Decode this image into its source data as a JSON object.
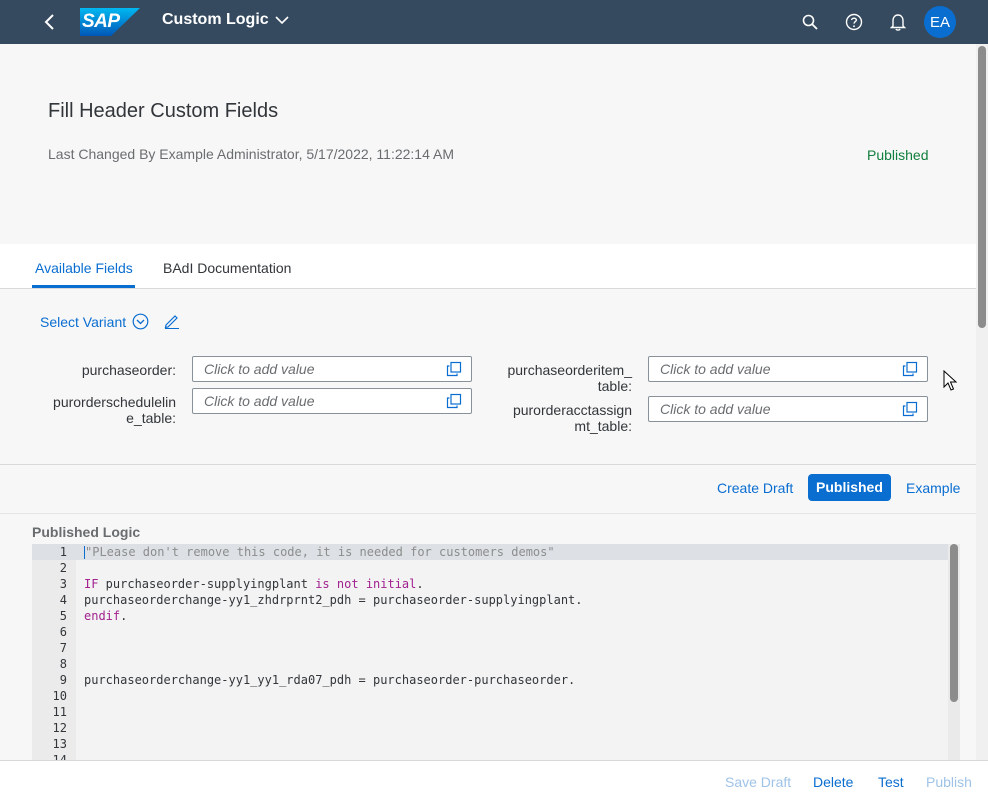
{
  "shell": {
    "logo_text": "SAP",
    "app_title": "Custom Logic",
    "user_initials": "EA"
  },
  "header": {
    "title": "Fill Header Custom Fields",
    "last_changed": "Last Changed By Example Administrator, 5/17/2022, 11:22:14 AM",
    "status": "Published"
  },
  "tabs": [
    {
      "label": "Available Fields"
    },
    {
      "label": "BAdI Documentation"
    }
  ],
  "filter": {
    "variant_label": "Select Variant",
    "fields": [
      {
        "label_line1": "purchaseorder:",
        "label_line2": "",
        "placeholder": "Click to add value"
      },
      {
        "label_line1": "purorderschedulelin",
        "label_line2": "e_table:",
        "placeholder": "Click to add value"
      },
      {
        "label_line1": "purchaseorderitem_",
        "label_line2": "table:",
        "placeholder": "Click to add value"
      },
      {
        "label_line1": "purorderacctassign",
        "label_line2": "mt_table:",
        "placeholder": "Click to add value"
      }
    ]
  },
  "toolbar": {
    "create_draft": "Create Draft",
    "published": "Published",
    "example": "Example"
  },
  "code": {
    "title": "Published Logic",
    "lines": [
      {
        "num": "1",
        "text": "\"PLease don't remove this code, it is needed for customers demos\""
      },
      {
        "num": "2",
        "text": ""
      },
      {
        "num": "3",
        "text": "IF purchaseorder-supplyingplant is not initial."
      },
      {
        "num": "4",
        "text": "purchaseorderchange-yy1_zhdrprnt2_pdh = purchaseorder-supplyingplant."
      },
      {
        "num": "5",
        "text": "endif."
      },
      {
        "num": "6",
        "text": ""
      },
      {
        "num": "7",
        "text": ""
      },
      {
        "num": "8",
        "text": ""
      },
      {
        "num": "9",
        "text": "purchaseorderchange-yy1_yy1_rda07_pdh = purchaseorder-purchaseorder."
      },
      {
        "num": "10",
        "text": ""
      },
      {
        "num": "11",
        "text": ""
      },
      {
        "num": "12",
        "text": ""
      },
      {
        "num": "13",
        "text": ""
      },
      {
        "num": "14",
        "text": ""
      }
    ]
  },
  "footer": {
    "save_draft": "Save Draft",
    "delete": "Delete",
    "test": "Test",
    "publish": "Publish"
  },
  "colors": {
    "shell_bg": "#354a5f",
    "accent": "#0a6ed1",
    "status_positive": "#107e3e",
    "keyword": "#a2228f",
    "comment": "#8c8c8c"
  },
  "icons": [
    "back-icon",
    "search-icon",
    "help-icon",
    "notification-icon",
    "chevron-down-icon",
    "edit-icon",
    "value-help-icon"
  ]
}
